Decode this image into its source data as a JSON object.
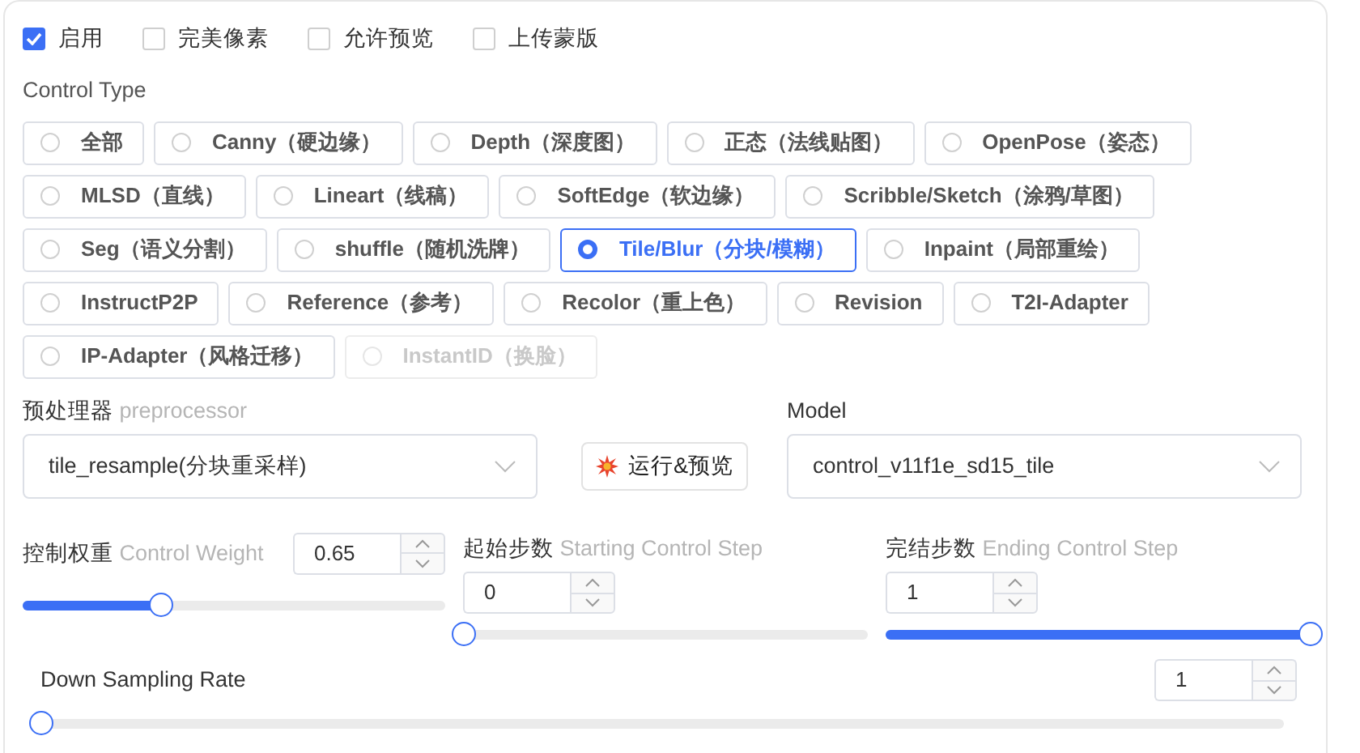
{
  "toggles": [
    {
      "label": "启用",
      "checked": true
    },
    {
      "label": "完美像素",
      "checked": false
    },
    {
      "label": "允许预览",
      "checked": false
    },
    {
      "label": "上传蒙版",
      "checked": false
    }
  ],
  "control_type": {
    "label": "Control Type",
    "rows": [
      {
        "options": [
          {
            "label": "全部",
            "selected": false,
            "disabled": false
          },
          {
            "label": "Canny（硬边缘）",
            "selected": false,
            "disabled": false
          },
          {
            "label": "Depth（深度图）",
            "selected": false,
            "disabled": false
          },
          {
            "label": "正态（法线贴图）",
            "selected": false,
            "disabled": false
          },
          {
            "label": "OpenPose（姿态）",
            "selected": false,
            "disabled": false
          }
        ]
      },
      {
        "options": [
          {
            "label": "MLSD（直线）",
            "selected": false,
            "disabled": false
          },
          {
            "label": "Lineart（线稿）",
            "selected": false,
            "disabled": false
          },
          {
            "label": "SoftEdge（软边缘）",
            "selected": false,
            "disabled": false
          },
          {
            "label": "Scribble/Sketch（涂鸦/草图）",
            "selected": false,
            "disabled": false
          }
        ]
      },
      {
        "options": [
          {
            "label": "Seg（语义分割）",
            "selected": false,
            "disabled": false
          },
          {
            "label": "shuffle（随机洗牌）",
            "selected": false,
            "disabled": false
          },
          {
            "label": "Tile/Blur（分块/模糊）",
            "selected": true,
            "disabled": false
          },
          {
            "label": "Inpaint（局部重绘）",
            "selected": false,
            "disabled": false
          }
        ]
      },
      {
        "options": [
          {
            "label": "InstructP2P",
            "selected": false,
            "disabled": false
          },
          {
            "label": "Reference（参考）",
            "selected": false,
            "disabled": false
          },
          {
            "label": "Recolor（重上色）",
            "selected": false,
            "disabled": false
          },
          {
            "label": "Revision",
            "selected": false,
            "disabled": false
          },
          {
            "label": "T2I-Adapter",
            "selected": false,
            "disabled": false
          }
        ]
      },
      {
        "options": [
          {
            "label": "IP-Adapter（风格迁移）",
            "selected": false,
            "disabled": false
          },
          {
            "label": "InstantID（换脸）",
            "selected": false,
            "disabled": true
          }
        ]
      }
    ]
  },
  "preprocessor": {
    "label": "预处理器",
    "hint": "preprocessor",
    "value": "tile_resample(分块重采样)"
  },
  "run_button": {
    "label": "运行&预览"
  },
  "model": {
    "label": "Model",
    "value": "control_v11f1e_sd15_tile"
  },
  "sliders": [
    {
      "label": "控制权重",
      "hint": "Control Weight",
      "value": "0.65",
      "level": 0.325
    },
    {
      "label": "起始步数",
      "hint": "Starting Control Step",
      "value": "0",
      "level": 0
    },
    {
      "label": "完结步数",
      "hint": "Ending Control Step",
      "value": "1",
      "level": 1
    }
  ],
  "down_sampling": {
    "label": "Down Sampling Rate",
    "value": "1",
    "level": 0
  }
}
